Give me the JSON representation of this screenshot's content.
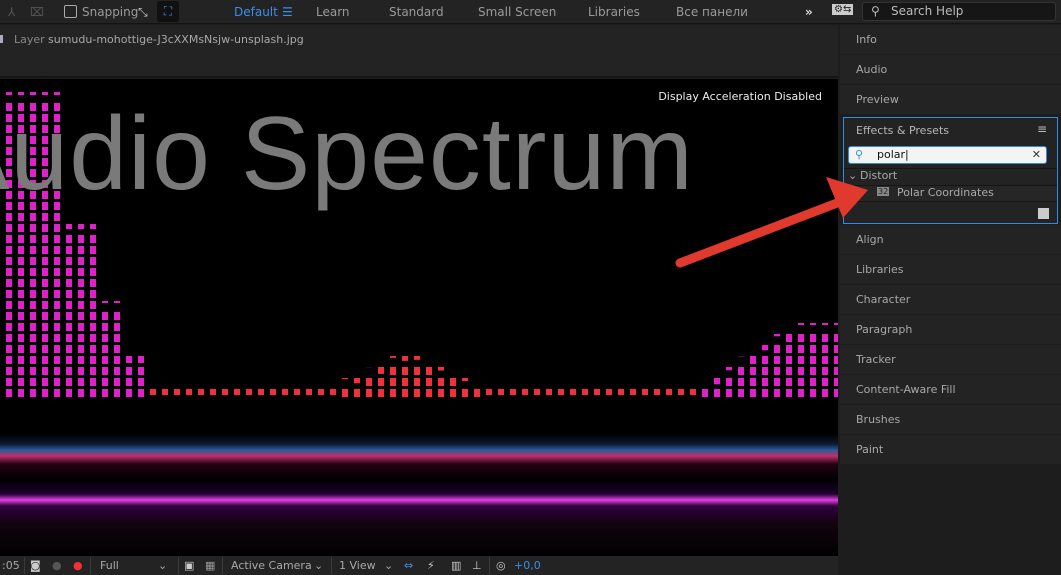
{
  "toolbar": {
    "snapping_label": "Snapping",
    "workspaces": [
      "Default",
      "Learn",
      "Standard",
      "Small Screen",
      "Libraries",
      "Все панели"
    ],
    "active_workspace": "Default",
    "search_help_placeholder": "Search Help",
    "accent": "#3b8fe5"
  },
  "layer_bar": {
    "prefix": "Layer",
    "name": "sumudu-mohottige-J3cXXMsNsjw-unsplash.jpg"
  },
  "viewer": {
    "overlay_text": "Audio Spectrum",
    "status": "Display Acceleration Disabled"
  },
  "bottom_bar": {
    "timecode": ":05",
    "resolution": "Full",
    "camera": "Active Camera",
    "views": "1 View",
    "exposure": "+0,0"
  },
  "right_panel": {
    "top_items": [
      "Info",
      "Audio",
      "Preview"
    ],
    "effects": {
      "title": "Effects & Presets",
      "search_value": "polar",
      "category": "Distort",
      "result": "Polar Coordinates"
    },
    "bottom_items": [
      "Align",
      "Libraries",
      "Character",
      "Paragraph",
      "Tracker",
      "Content-Aware Fill",
      "Brushes",
      "Paint"
    ]
  },
  "annotation": {
    "arrow_color": "#e0392e"
  }
}
